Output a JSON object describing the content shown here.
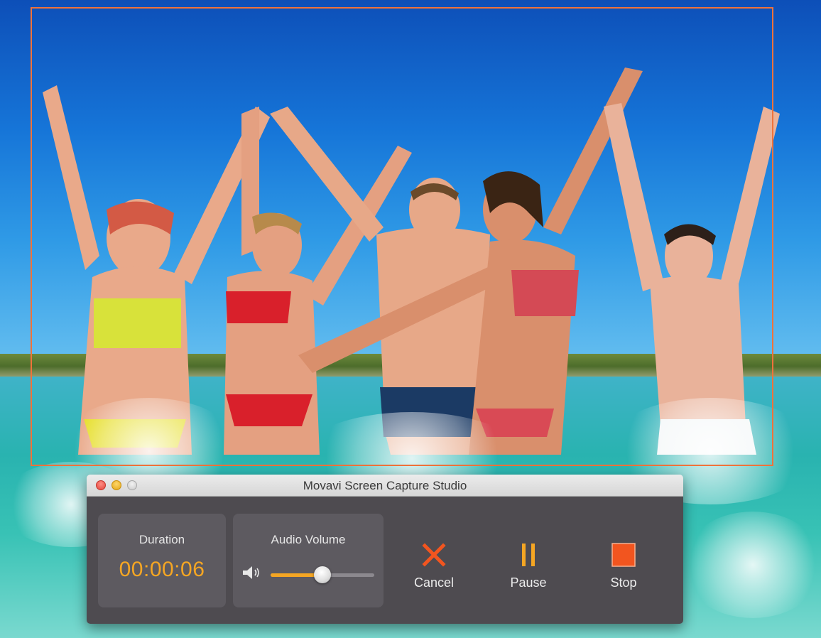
{
  "window": {
    "title": "Movavi Screen Capture Studio"
  },
  "duration": {
    "label": "Duration",
    "value": "00:00:06"
  },
  "audio": {
    "label": "Audio Volume",
    "volume_fraction": 0.5,
    "icon": "speaker-icon"
  },
  "controls": {
    "cancel": {
      "label": "Cancel",
      "icon": "x-icon"
    },
    "pause": {
      "label": "Pause",
      "icon": "pause-icon"
    },
    "stop": {
      "label": "Stop",
      "icon": "stop-icon"
    }
  },
  "colors": {
    "accent": "#f5a623",
    "capture_frame": "#f0723a",
    "cancel_icon": "#f2551f",
    "stop_icon": "#f2551f"
  }
}
